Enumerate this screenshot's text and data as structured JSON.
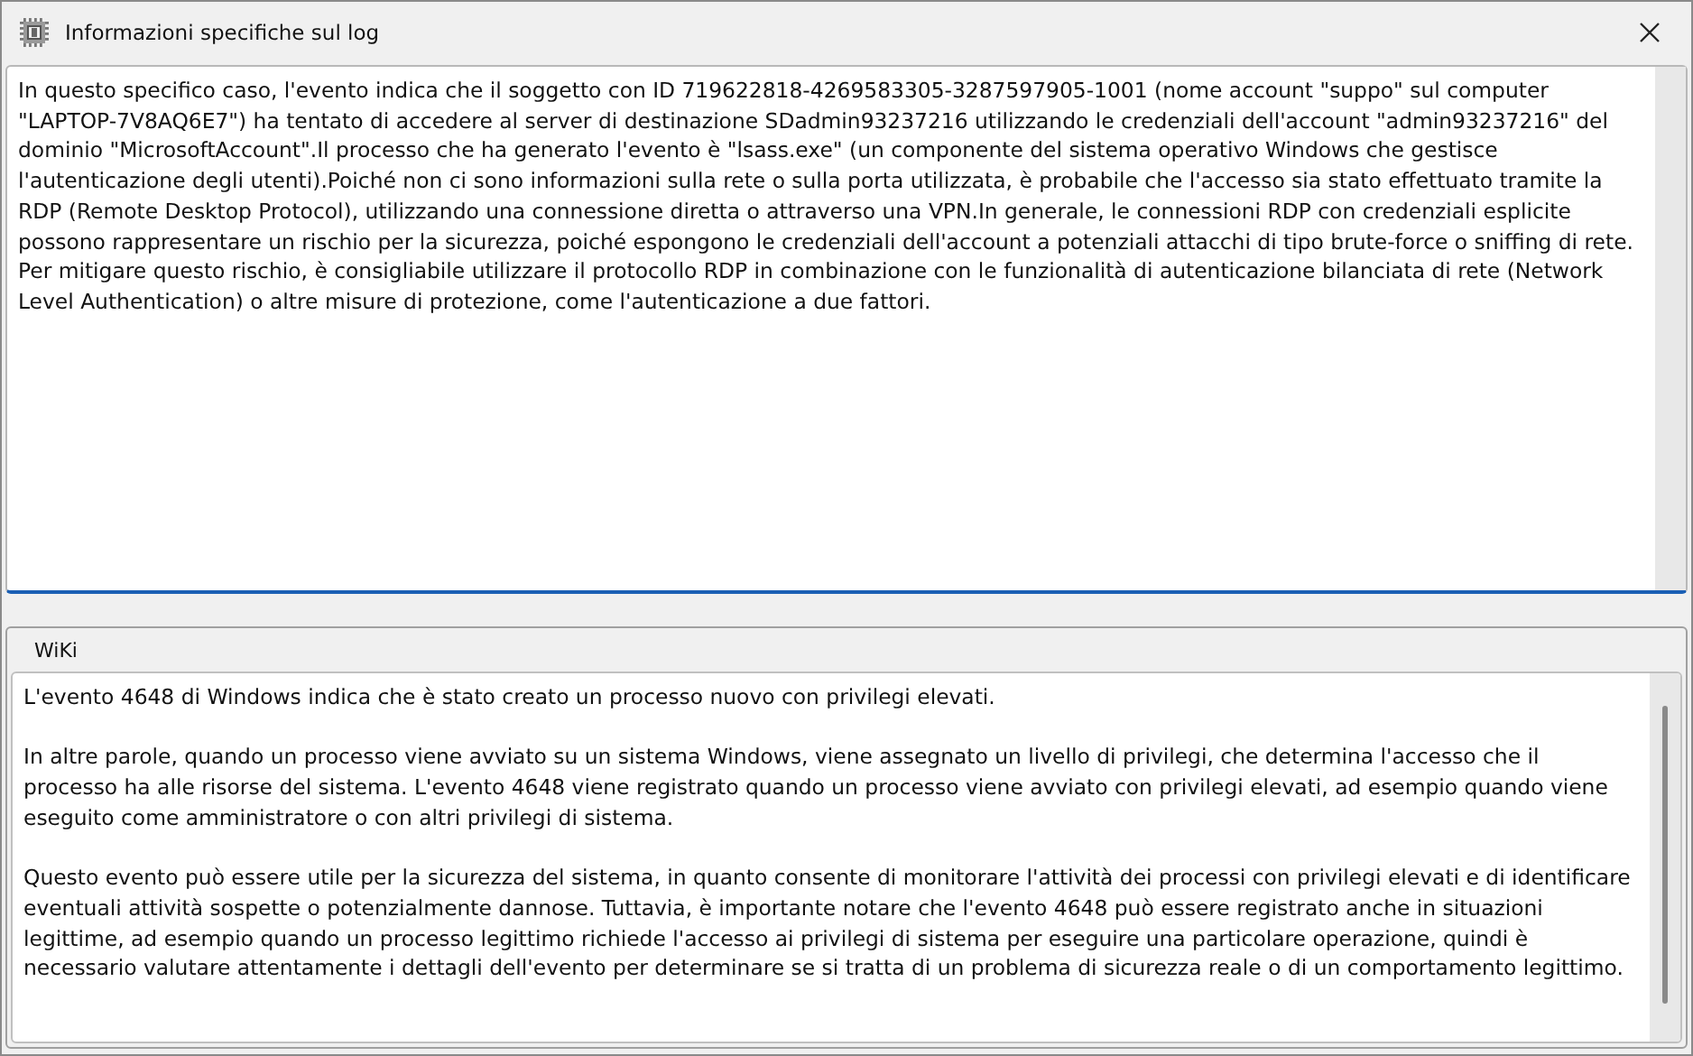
{
  "window": {
    "title": "Informazioni specifiche sul log"
  },
  "log_text": "In questo specifico caso, l'evento indica che il soggetto con ID 719622818-4269583305-3287597905-1001 (nome account \"suppo\" sul computer \"LAPTOP-7V8AQ6E7\") ha tentato di accedere al server di destinazione SDadmin93237216 utilizzando le credenziali dell'account \"admin93237216\" del dominio \"MicrosoftAccount\".Il processo che ha generato l'evento è \"lsass.exe\" (un componente del sistema operativo Windows che gestisce l'autenticazione degli utenti).Poiché non ci sono informazioni sulla rete o sulla porta utilizzata, è probabile che l'accesso sia stato effettuato tramite la RDP (Remote Desktop Protocol), utilizzando una connessione diretta o attraverso una VPN.In generale, le connessioni RDP con credenziali esplicite possono rappresentare un rischio per la sicurezza, poiché espongono le credenziali dell'account a potenziali attacchi di tipo brute-force o sniffing di rete. Per mitigare questo rischio, è consigliabile utilizzare il protocollo RDP in combinazione con le funzionalità di autenticazione bilanciata di rete (Network Level Authentication) o altre misure di protezione, come l'autenticazione a due fattori.",
  "wiki": {
    "title": "WiKi",
    "paragraphs": [
      "L'evento 4648 di Windows indica che è stato creato un processo nuovo con privilegi elevati.",
      "In altre parole, quando un processo viene avviato su un sistema Windows, viene assegnato un livello di privilegi, che determina l'accesso che il processo ha alle risorse del sistema. L'evento 4648 viene registrato quando un processo viene avviato con privilegi elevati, ad esempio quando viene eseguito come amministratore o con altri privilegi di sistema.",
      "Questo evento può essere utile per la sicurezza del sistema, in quanto consente di monitorare l'attività dei processi con privilegi elevati e di identificare eventuali attività sospette o potenzialmente dannose. Tuttavia, è importante notare che l'evento 4648 può essere registrato anche in situazioni legittime, ad esempio quando un processo legittimo richiede l'accesso ai privilegi di sistema per eseguire una particolare operazione, quindi è necessario valutare attentamente i dettagli dell'evento per determinare se si tratta di un problema di sicurezza reale o di un comportamento legittimo."
    ]
  }
}
